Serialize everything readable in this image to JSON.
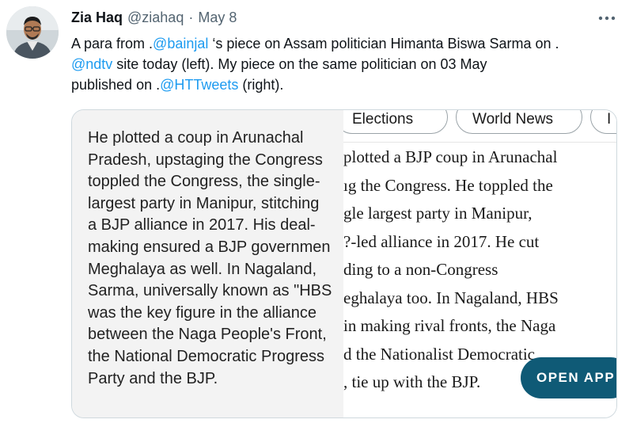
{
  "tweet": {
    "author_name": "Zia Haq",
    "handle": "@ziahaq",
    "separator": "·",
    "date": "May 8",
    "more_icon": "more-options-icon",
    "text_lines": [
      [
        {
          "text": "A para from .",
          "mention": false
        },
        {
          "text": "@bainjal",
          "mention": true
        },
        {
          "text": " ‘s piece on Assam politician Himanta Biswa Sarma on .",
          "mention": false
        }
      ],
      [
        {
          "text": "@ndtv",
          "mention": true
        },
        {
          "text": " site today (left). My piece on the same politician on 03 May",
          "mention": false
        }
      ],
      [
        {
          "text": "published on .",
          "mention": false
        },
        {
          "text": "@HTTweets",
          "mention": true
        },
        {
          "text": " (right).",
          "mention": false
        }
      ]
    ]
  },
  "media": {
    "left_lines": [
      "He plotted a coup in Arunachal",
      "Pradesh, upstaging the Congress",
      "toppled the Congress, the single-",
      "largest party in Manipur, stitching",
      "a BJP alliance in 2017. His deal-",
      "making ensured a BJP governmen",
      "Meghalaya as well. In Nagaland,",
      "Sarma, universally known as \"HBS",
      "was the key figure in the alliance",
      "between the Naga People's Front,",
      "the National Democratic Progress",
      "Party and the BJP."
    ],
    "chips": [
      "Elections",
      "World News",
      "I"
    ],
    "right_lines": [
      "plotted a BJP coup in Arunachal",
      "ıg the Congress. He toppled the",
      "gle largest party in Manipur,",
      "?-led alliance in 2017. He cut",
      "ding to a non-Congress",
      "eghalaya too. In Nagaland, HBS",
      " in making rival fronts, the Naga",
      "d the Nationalist Democratic",
      ", tie up with the BJP."
    ],
    "open_app_label": "OPEN APP"
  }
}
